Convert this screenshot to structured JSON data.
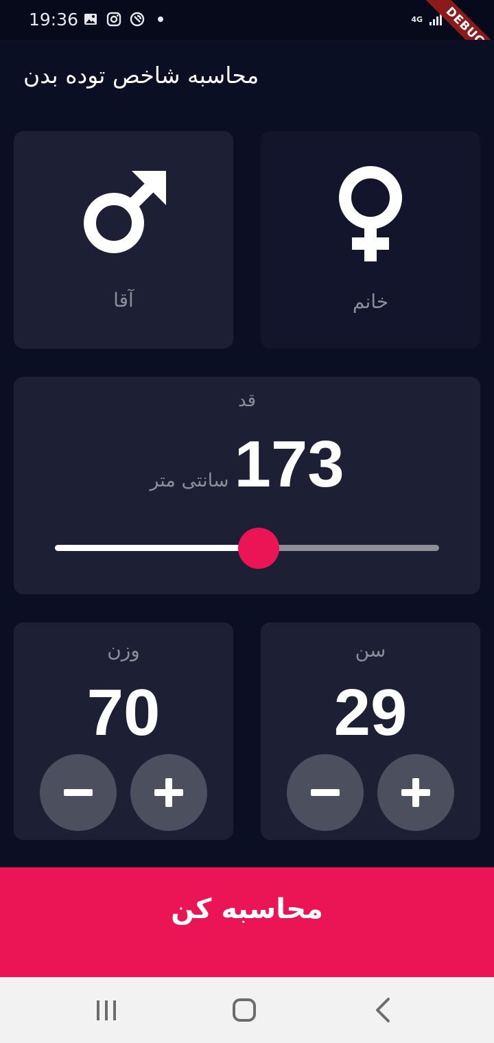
{
  "status_bar": {
    "time": "19:36",
    "network_label": "4G",
    "icons": [
      "image-icon",
      "instagram-icon",
      "sync-icon",
      "dot-icon",
      "signal-icon",
      "battery-icon"
    ]
  },
  "debug_banner": "DEBUG",
  "app_bar": {
    "title": "محاسبه شاخص توده بدن"
  },
  "gender": {
    "male": {
      "label": "آقا",
      "icon": "male-icon",
      "selected": true
    },
    "female": {
      "label": "خانم",
      "icon": "female-icon",
      "selected": false
    }
  },
  "height": {
    "label": "قد",
    "value": "173",
    "unit": "سانتی متر",
    "slider_fraction": 0.53
  },
  "weight": {
    "label": "وزن",
    "value": "70"
  },
  "age": {
    "label": "سن",
    "value": "29"
  },
  "calculate_button": {
    "label": "محاسبه کن"
  },
  "colors": {
    "background": "#0b0f23",
    "active_card": "#1d1f34",
    "inactive_card": "#12152b",
    "accent": "#eb1555",
    "label_gray": "#8d8e98",
    "round_button": "#4c4f5e"
  },
  "nav_bar": {
    "buttons": [
      "recent-apps-icon",
      "home-icon",
      "back-icon"
    ]
  }
}
